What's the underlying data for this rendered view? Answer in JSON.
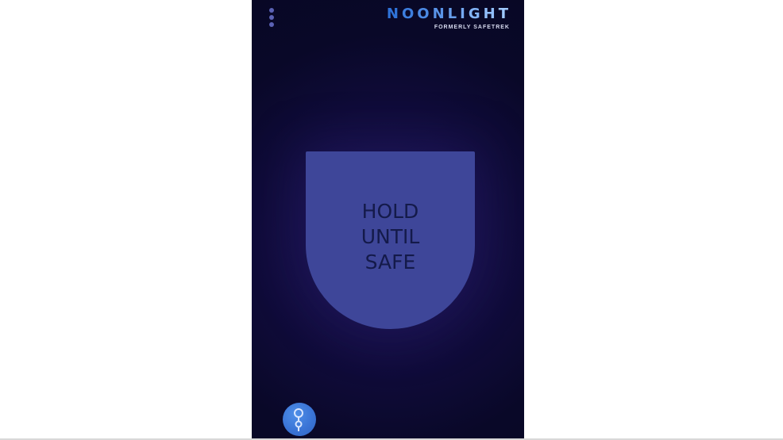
{
  "app": {
    "brand": {
      "logo_letters": [
        "N",
        "O",
        "O",
        "N",
        "L",
        "I",
        "G",
        "H",
        "T"
      ],
      "tagline": "FORMERLY SAFETREK"
    },
    "hold_button": {
      "lines": [
        "HOLD",
        "UNTIL",
        "SAFE"
      ]
    },
    "icons": {
      "menu": "vertical-dots-menu-icon",
      "timer": "timer-chain-icon"
    },
    "colors": {
      "background": "#090828",
      "hold_button": "#3e4699",
      "hold_text": "#141a4a",
      "logo_gradient": [
        "#2f73d9",
        "#9fc9ff"
      ],
      "timer_button": "#3a74d6",
      "menu_dots": "#5b62b5"
    }
  }
}
